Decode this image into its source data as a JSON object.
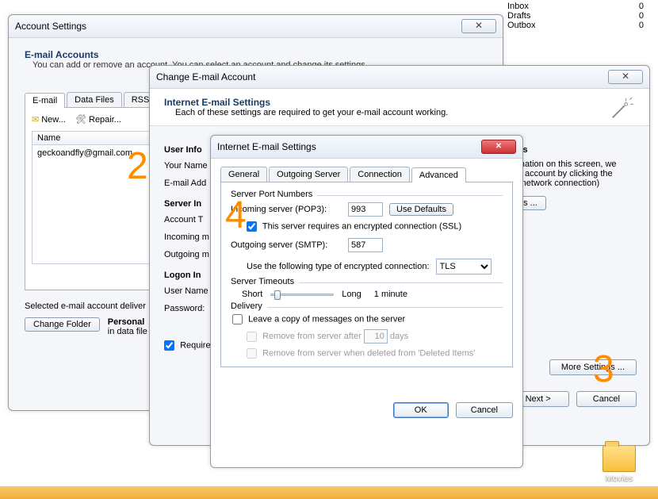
{
  "mail_panel": {
    "rows": [
      {
        "label": "Inbox",
        "count": "0"
      },
      {
        "label": "Drafts",
        "count": "0"
      },
      {
        "label": "Outbox",
        "count": "0"
      }
    ]
  },
  "desktop": {
    "folder_label": "Movies"
  },
  "account_settings": {
    "title": "Account Settings",
    "header": "E-mail Accounts",
    "subtext": "You can add or remove an account. You can select an account and change its settings.",
    "tabs": {
      "email": "E-mail",
      "data_files": "Data Files",
      "rss": "RSS Feed"
    },
    "toolbar": {
      "new": "New...",
      "repair": "Repair..."
    },
    "columns": {
      "name": "Name"
    },
    "account_email": "geckoandfly@gmail.com",
    "selected_text": "Selected e-mail account deliver",
    "change_folder_btn": "Change Folder",
    "personal_text": "Personal",
    "in_data_file_text": "in data file"
  },
  "change_account": {
    "title": "Change E-mail Account",
    "header": "Internet E-mail Settings",
    "subtext": "Each of these settings are required to get your e-mail account working.",
    "groups": {
      "user_info": "User Info",
      "server_info": "Server In",
      "logon_info": "Logon In"
    },
    "labels": {
      "your_name": "Your Name",
      "email_addr": "E-mail Add",
      "account_t": "Account T",
      "incoming_m": "Incoming m",
      "outgoing_m": "Outgoing m",
      "user_name": "User Name",
      "password": "Password:"
    },
    "require_checkbox": "Require",
    "right_side": {
      "ings_suffix": "ings",
      "info1": "ormation on this screen, we",
      "info2": "our account by clicking the",
      "info3": "es network connection)",
      "gs_btn": "gs ...",
      "more_settings_btn": "More Settings ..."
    },
    "buttons": {
      "next": "Next >",
      "cancel": "Cancel"
    }
  },
  "advanced_dialog": {
    "title": "Internet E-mail Settings",
    "tabs": {
      "general": "General",
      "outgoing": "Outgoing Server",
      "connection": "Connection",
      "advanced": "Advanced"
    },
    "groups": {
      "server_ports": "Server Port Numbers",
      "timeouts": "Server Timeouts",
      "delivery": "Delivery"
    },
    "incoming_label": "Incoming server (POP3):",
    "incoming_value": "993",
    "use_defaults_btn": "Use Defaults",
    "ssl_checkbox": "This server requires an encrypted connection (SSL)",
    "outgoing_label": "Outgoing server (SMTP):",
    "outgoing_value": "587",
    "encryption_label": "Use the following type of encrypted connection:",
    "encryption_value": "TLS",
    "timeout_short": "Short",
    "timeout_long": "Long",
    "timeout_value": "1 minute",
    "leave_copy": "Leave a copy of messages on the server",
    "remove_after": "Remove from server after",
    "remove_after_value": "10",
    "remove_after_unit": "days",
    "remove_deleted": "Remove from server when deleted from 'Deleted Items'",
    "buttons": {
      "ok": "OK",
      "cancel": "Cancel"
    }
  },
  "annotations": {
    "two": "2",
    "three": "3",
    "four": "4"
  }
}
